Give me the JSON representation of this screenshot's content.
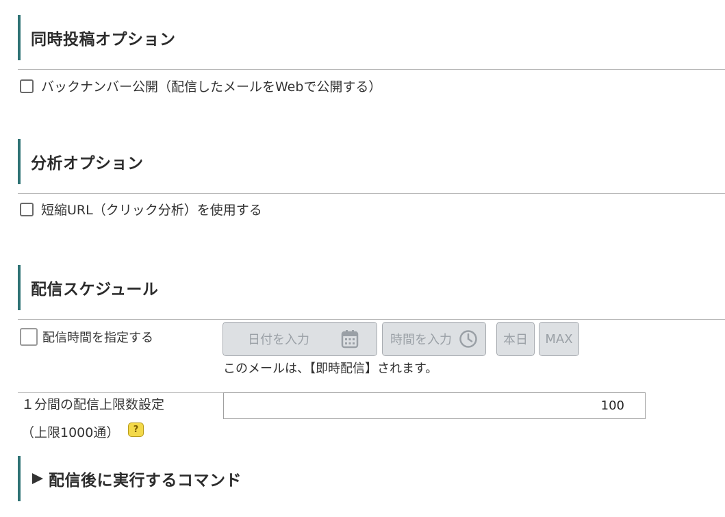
{
  "sections": {
    "simultaneous": {
      "title": "同時投稿オプション",
      "backnumber_label": "バックナンバー公開（配信したメールをWebで公開する）"
    },
    "analysis": {
      "title": "分析オプション",
      "shorturl_label": "短縮URL（クリック分析）を使用する"
    },
    "schedule": {
      "title": "配信スケジュール",
      "specify_time_label": "配信時間を指定する",
      "date_placeholder": "日付を入力",
      "time_placeholder": "時間を入力",
      "today_label": "本日",
      "max_label": "MAX",
      "notice": "このメールは、【即時配信】されます。",
      "rate_label_line1": "１分間の配信上限数設定",
      "rate_label_line2": "（上限1000通）",
      "rate_value": "100",
      "help_glyph": "?"
    },
    "command": {
      "title": "配信後に実行するコマンド"
    }
  },
  "colors": {
    "accent_border": "#2e7274",
    "disabled_button_bg": "#dde0e3",
    "help_icon_bg": "#f3d94a"
  },
  "icons": {
    "calendar": "calendar-icon",
    "clock": "clock-icon",
    "help": "help-icon",
    "expand": "triangle-right-icon"
  }
}
